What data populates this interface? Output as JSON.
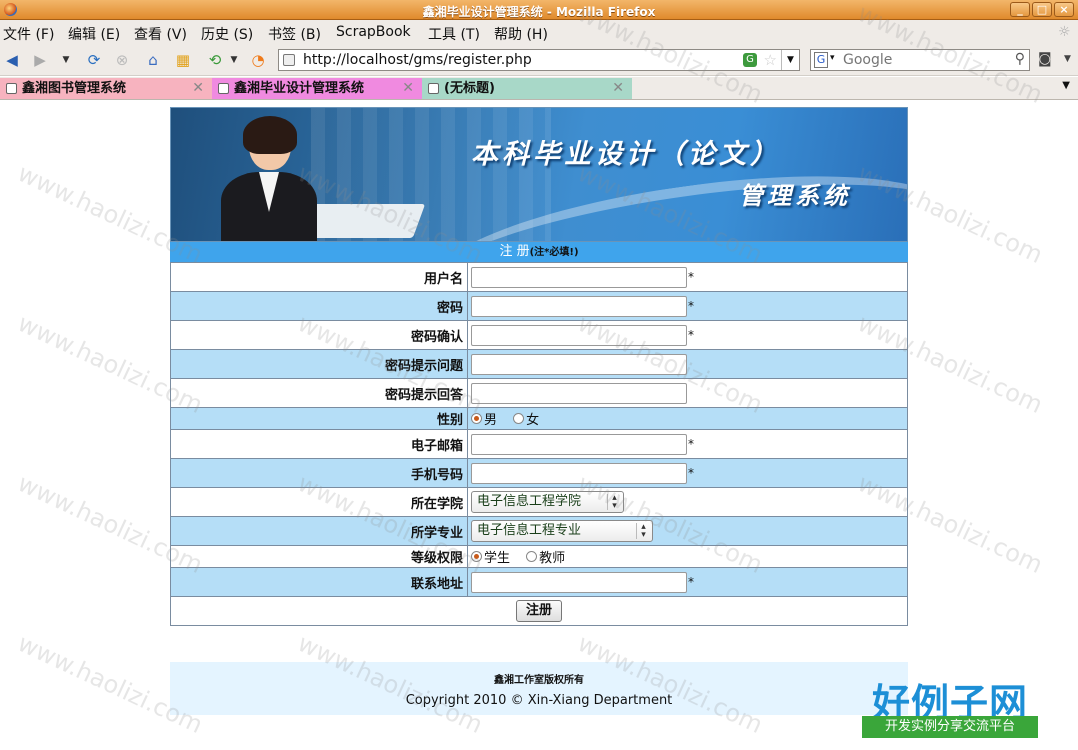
{
  "window": {
    "title": "鑫湘毕业设计管理系统 - Mozilla Firefox"
  },
  "menu": [
    {
      "label": "文件 (F)"
    },
    {
      "label": "编辑 (E)"
    },
    {
      "label": "查看 (V)"
    },
    {
      "label": "历史 (S)"
    },
    {
      "label": "书签 (B)"
    },
    {
      "label": "ScrapBook"
    },
    {
      "label": "工具 (T)"
    },
    {
      "label": "帮助 (H)"
    }
  ],
  "address": {
    "url": "http://localhost/gms/register.php"
  },
  "search": {
    "placeholder": "Google"
  },
  "tabs": [
    {
      "label": "鑫湘图书管理系统"
    },
    {
      "label": "鑫湘毕业设计管理系统"
    },
    {
      "label": "(无标题)"
    }
  ],
  "banner": {
    "line1": "本科毕业设计（论文）",
    "line2": "管理系统"
  },
  "form": {
    "heading": "注 册",
    "heading_note": "(注*必填!)",
    "required_mark": "*",
    "fields": {
      "username": "用户名",
      "password": "密码",
      "password_confirm": "密码确认",
      "hint_question": "密码提示问题",
      "hint_answer": "密码提示回答",
      "gender": "性别",
      "email": "电子邮箱",
      "phone": "手机号码",
      "college": "所在学院",
      "major": "所学专业",
      "level": "等级权限",
      "address": "联系地址"
    },
    "gender_options": [
      "男",
      "女"
    ],
    "level_options": [
      "学生",
      "教师"
    ],
    "college_selected": "电子信息工程学院",
    "major_selected": "电子信息工程专业",
    "submit_label": "注册"
  },
  "footer": {
    "line1": "鑫湘工作室版权所有",
    "line2": "Copyright 2010 © Xin-Xiang Department"
  },
  "watermark": {
    "text": "www.haolizi.com",
    "brand": "好例子网",
    "tagline": "开发实例分享交流平台"
  },
  "colors": {
    "title_bar": "#e08a2c",
    "form_header": "#3fa4ec",
    "row_highlight": "#b5def7",
    "footer_bg": "#e4f4ff",
    "tab_active": "#f08ae0",
    "tab_first": "#f7b3bf",
    "tab_third": "#a8d8c8"
  }
}
